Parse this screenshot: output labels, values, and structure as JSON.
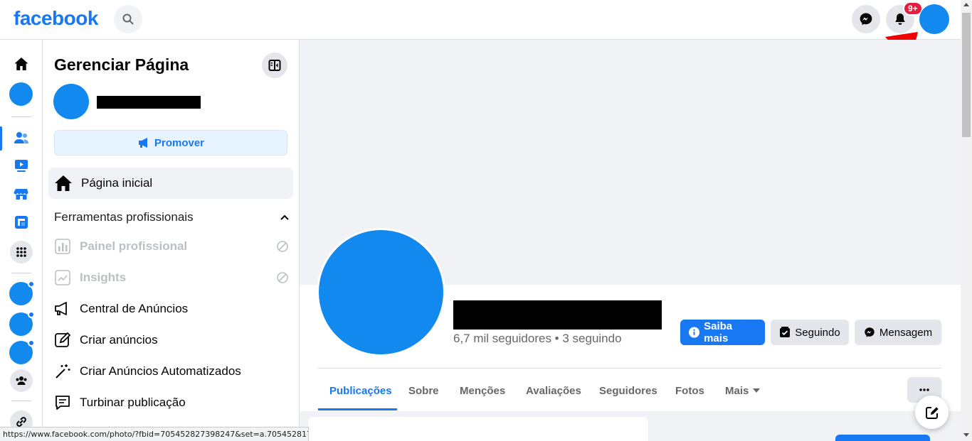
{
  "header": {
    "logo": "facebook",
    "notifications_badge": "9+"
  },
  "icons": {
    "search": "search-icon",
    "messenger": "messenger-icon",
    "notifications": "bell-icon"
  },
  "colors": {
    "brand": "#1877f2",
    "avatar": "#1189ee",
    "badge": "#e41e3f",
    "annotation_arrow": "#f20000"
  },
  "panel": {
    "title": "Gerenciar Página",
    "promote_label": "Promover",
    "home_label": "Página inicial",
    "section_title": "Ferramentas profissionais",
    "items": [
      {
        "label": "Painel profissional",
        "disabled": true
      },
      {
        "label": "Insights",
        "disabled": true
      },
      {
        "label": "Central de Anúncios",
        "disabled": false
      },
      {
        "label": "Criar anúncios",
        "disabled": false
      },
      {
        "label": "Criar Anúncios Automatizados",
        "disabled": false
      },
      {
        "label": "Turbinar publicação",
        "disabled": false
      }
    ]
  },
  "profile": {
    "stats": "6,7 mil seguidores • 3 seguindo",
    "buttons": {
      "learn_more": "Saiba mais",
      "following": "Seguindo",
      "message": "Mensagem"
    }
  },
  "tabs": [
    {
      "label": "Publicações",
      "active": true
    },
    {
      "label": "Sobre",
      "active": false
    },
    {
      "label": "Menções",
      "active": false
    },
    {
      "label": "Avaliações",
      "active": false
    },
    {
      "label": "Seguidores",
      "active": false
    },
    {
      "label": "Fotos",
      "active": false
    },
    {
      "label": "Mais",
      "active": false
    }
  ],
  "status_url": "https://www.facebook.com/photo/?fbid=705452827398247&set=a.70545281739"
}
